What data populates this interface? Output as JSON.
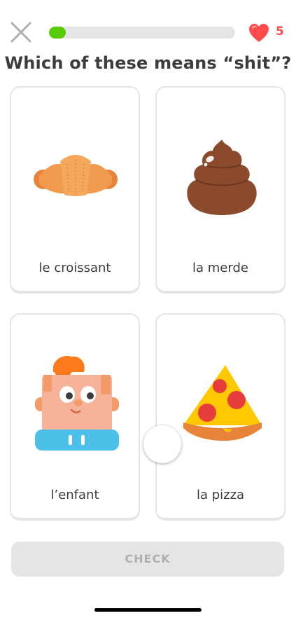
{
  "header": {
    "close_icon": "close-icon",
    "progress": 0.09,
    "progress_color": "#58cc02",
    "heart_icon": "heart-icon",
    "hearts": "5",
    "heart_color": "#ff4b4b"
  },
  "question": "Which of these means “shit”?",
  "options": [
    {
      "label": "le croissant",
      "icon": "croissant-icon"
    },
    {
      "label": "la merde",
      "icon": "poop-icon"
    },
    {
      "label": "l’enfant",
      "icon": "child-icon"
    },
    {
      "label": "la pizza",
      "icon": "pizza-icon"
    }
  ],
  "check_label": "CHECK"
}
